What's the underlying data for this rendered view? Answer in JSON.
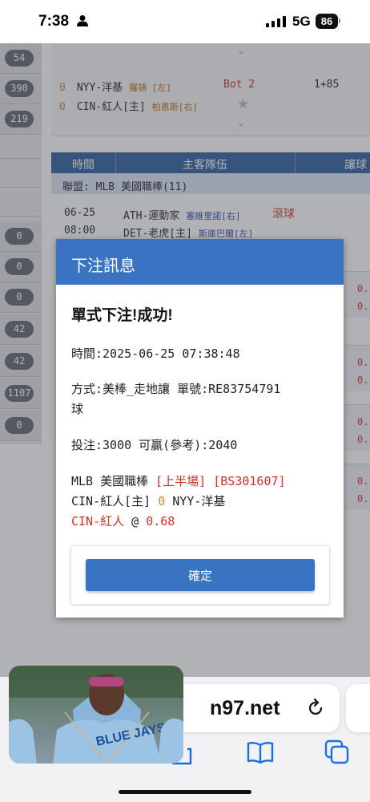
{
  "status_bar": {
    "time": "7:38",
    "network": "5G",
    "battery": "86"
  },
  "sidebar": {
    "badges": [
      "54",
      "390",
      "219",
      "0",
      "0",
      "0",
      "42",
      "42",
      "1107",
      "0"
    ]
  },
  "match_card": {
    "away": {
      "index": "0",
      "team": "NYY-洋基",
      "pitcher": "羅頓 [左]"
    },
    "home": {
      "index": "0",
      "team": "CIN-紅人[主]",
      "pitcher": "柏恩斯[右]"
    },
    "inning": "Bot 2",
    "line": "1+85"
  },
  "table_header": {
    "col_time": "時間",
    "col_teams": "主客隊伍",
    "col_spread": "讓球"
  },
  "league_row": "聯盟: MLB 美國職棒(11)",
  "game_row": {
    "date": "06-25",
    "time": "08:00",
    "away_team": "ATH-運動家",
    "away_pitcher": "塞維里諾[右]",
    "home_team": "DET-老虎[主]",
    "home_pitcher": "斯庫巴爾[左]",
    "live_label": "滾球"
  },
  "odds_column": [
    "0.",
    "0.",
    "0.",
    "0.",
    "0.",
    "0.",
    "0.",
    "0."
  ],
  "modal": {
    "title": "下注訊息",
    "result": "單式下注!成功!",
    "time_line": "時間:2025-06-25 07:38:48",
    "method_line1": "方式:美棒_走地讓  單號:RE83754791",
    "method_line2": "球",
    "stake_line": "投注:3000        可贏(參考):2040",
    "league": "MLB 美國職棒",
    "period_tag": "[上半場]",
    "bet_code": "[BS301607]",
    "matchup_home": "CIN-紅人[主]",
    "matchup_handicap": "0",
    "matchup_away": "NYY-洋基",
    "pick_team": "CIN-紅人",
    "pick_at": "@",
    "pick_odds": "0.68",
    "confirm_label": "確定"
  },
  "browser": {
    "url_fragment": "n97.net"
  },
  "icons": [
    "person-icon",
    "signal-icon",
    "battery-icon",
    "chevron-down-icon",
    "star-icon",
    "reload-icon",
    "bookmarks-icon",
    "tabs-icon"
  ]
}
